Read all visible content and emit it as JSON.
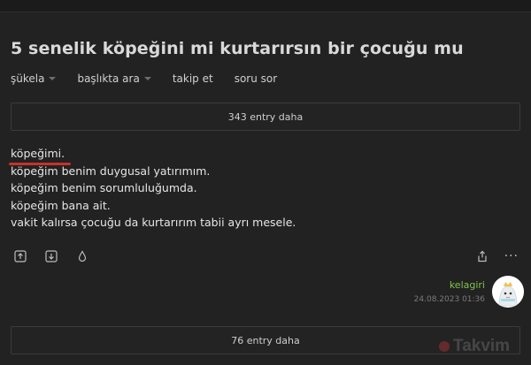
{
  "page": {
    "title": "5 senelik köpeğini mi kurtarırsın bir çocuğu mu"
  },
  "subnav": {
    "items": [
      {
        "label": "şükela",
        "has_caret": true
      },
      {
        "label": "başlıkta ara",
        "has_caret": true
      },
      {
        "label": "takip et",
        "has_caret": false
      },
      {
        "label": "soru sor",
        "has_caret": false
      }
    ]
  },
  "more_top": {
    "label": "343 entry daha"
  },
  "entry": {
    "lines": [
      "köpeğimi.",
      "köpeğim benim duygusal yatırımım.",
      "köpeğim benim sorumluluğumda.",
      "köpeğim bana ait.",
      "vakit kalırsa çocuğu da kurtarırım tabii ayrı mesele."
    ],
    "author": "kelagiri",
    "date": "24.08.2023 01:36"
  },
  "actions": {
    "left_icons": [
      "upvote-icon",
      "downvote-icon",
      "drop-icon"
    ],
    "right_icons": [
      "share-icon",
      "more-dots-icon"
    ],
    "dots_label": "···"
  },
  "more_bottom": {
    "label": "76 entry daha"
  },
  "watermark": {
    "text": "Takvim"
  },
  "colors": {
    "background": "#222222",
    "text": "#e2e2e2",
    "author_green": "#81c14b",
    "underline_red": "#c9302c",
    "box_border": "#3b3b3b"
  }
}
